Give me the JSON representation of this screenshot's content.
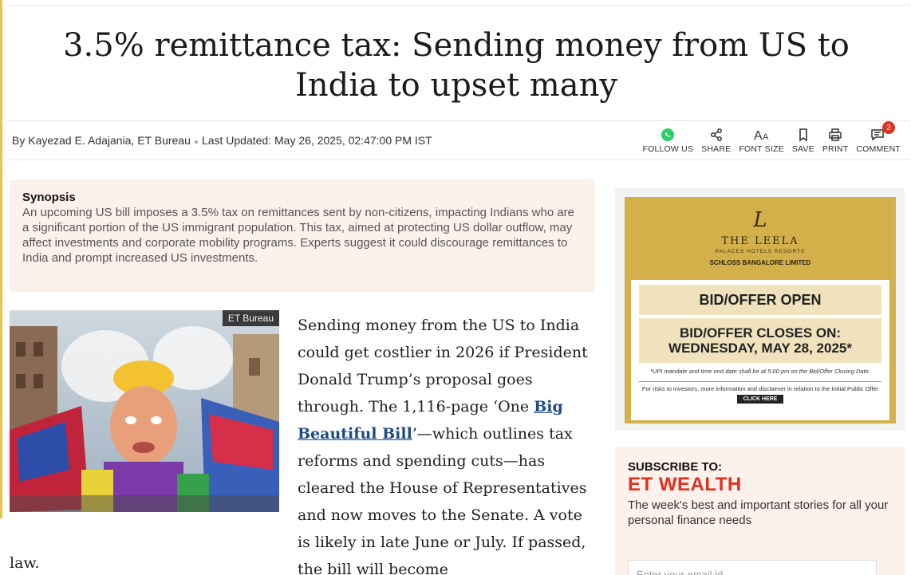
{
  "article": {
    "headline": "3.5% remittance tax: Sending money from US to India to upset many",
    "byline": {
      "author": "By Kayezad E. Adajania, ET Bureau",
      "updated": "Last Updated: May 26, 2025, 02:47:00 PM IST"
    },
    "actions": [
      {
        "label": "FOLLOW US",
        "icon": "whatsapp-icon"
      },
      {
        "label": "SHARE",
        "icon": "share-icon"
      },
      {
        "label": "FONT SIZE",
        "icon": "font-size-icon"
      },
      {
        "label": "SAVE",
        "icon": "bookmark-icon"
      },
      {
        "label": "PRINT",
        "icon": "print-icon"
      },
      {
        "label": "COMMENT",
        "icon": "comment-icon",
        "badge": "2"
      }
    ],
    "synopsis": {
      "title": "Synopsis",
      "text": "An upcoming US bill imposes a 3.5% tax on remittances sent by non-citizens, impacting Indians who are a significant portion of the US immigrant population. This tax, aimed at protecting US dollar outflow, may affect investments and corporate mobility programs. Experts suggest it could discourage remittances to India and prompt increased US investments."
    },
    "photo_tag": "ET Bureau",
    "body_part1": "Sending money from the US to India could get costlier in 2026 if President Donald Trump’s proposal goes through. The 1,116-page ‘One ",
    "body_link": "Big Beautiful Bill",
    "body_part2": "’—which outlines tax reforms and spending cuts—has cleared the House of Representatives and now moves to the Senate. A vote is likely in late June or July. If passed, the bill will become",
    "body_tail": "law."
  },
  "ad": {
    "logo": "L",
    "brand": "THE LEELA",
    "tagline": "PALACES HOTELS RESORTS",
    "company": "SCHLOSS BANGALORE LIMITED",
    "open_text": "BID/OFFER OPEN",
    "close_line1": "BID/OFFER CLOSES ON:",
    "close_line2": "WEDNESDAY, MAY 28, 2025*",
    "note": "*UPI mandate and time end date shall be at 5:00 pm on the Bid/Offer Closing Date.",
    "risk": "For risks to investors, more information and disclaimer in relation to the Initial Public Offer",
    "cta": "CLICK HERE"
  },
  "subscribe": {
    "heading": "SUBSCRIBE TO:",
    "brand": "ET WEALTH",
    "description": "The week's best and important stories for all your personal finance needs",
    "input_placeholder": "Enter your email id"
  },
  "colors": {
    "accent_red": "#e0301e",
    "synopsis_bg": "#fdf1ec",
    "ad_gold": "#d4b04b",
    "link_blue": "#1a4a8a"
  }
}
